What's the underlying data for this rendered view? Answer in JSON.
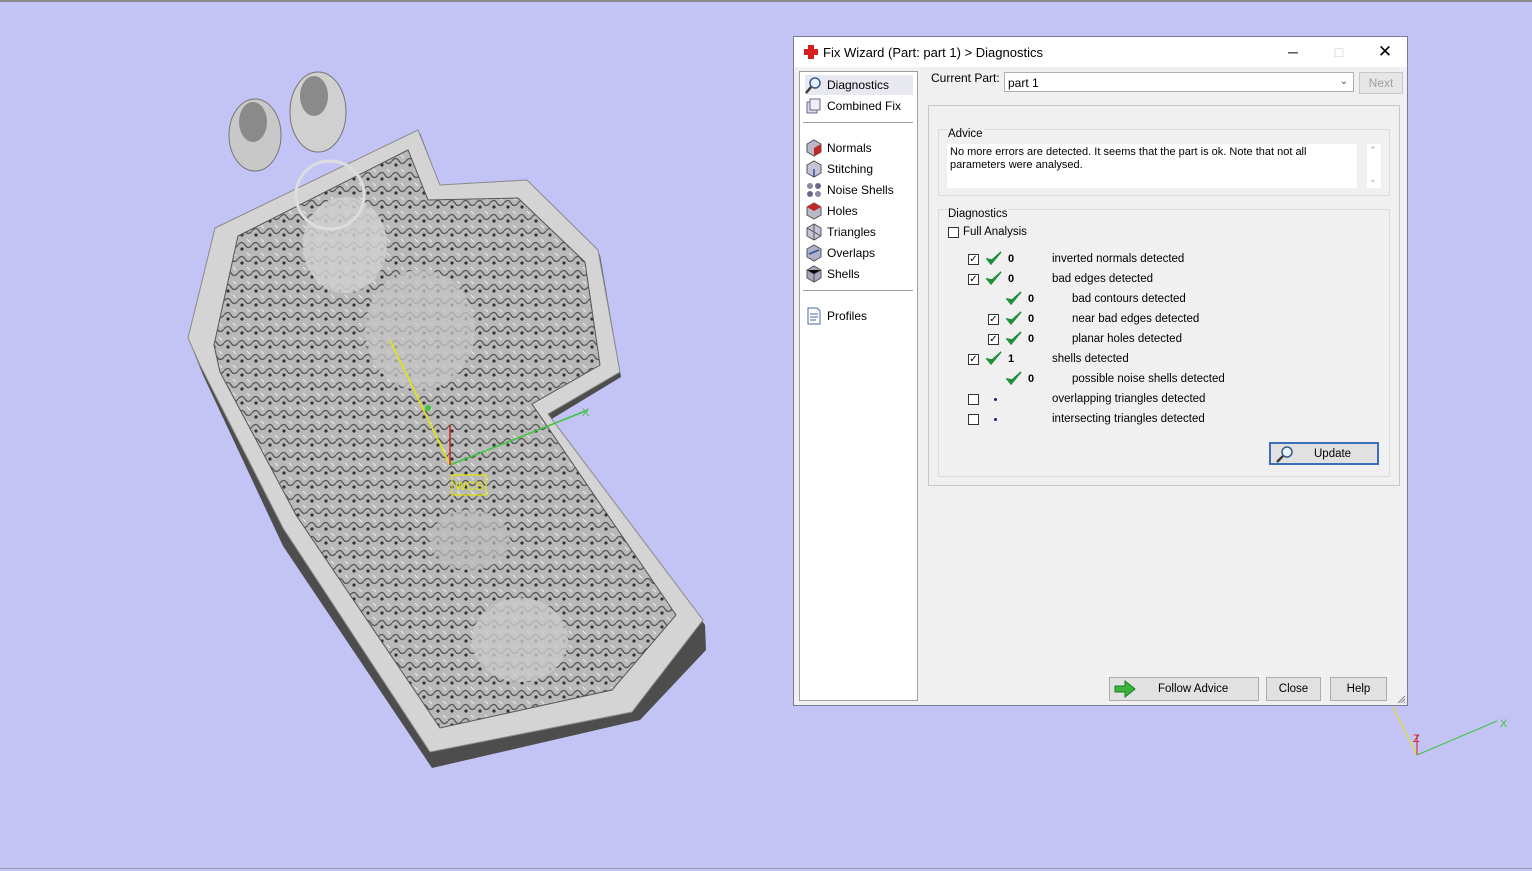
{
  "window": {
    "title": "Fix Wizard (Part: part 1) > Diagnostics",
    "controls": {
      "minimize": "─",
      "maximize": "□",
      "close": "✕"
    }
  },
  "nav": {
    "items": [
      {
        "label": "Diagnostics",
        "icon": "magnifier-icon",
        "selected": true
      },
      {
        "label": "Combined Fix",
        "icon": "combined-fix-icon",
        "selected": false
      },
      {
        "label": "Normals",
        "icon": "normals-cube-icon",
        "selected": false
      },
      {
        "label": "Stitching",
        "icon": "stitching-cube-icon",
        "selected": false
      },
      {
        "label": "Noise Shells",
        "icon": "noise-shells-icon",
        "selected": false
      },
      {
        "label": "Holes",
        "icon": "holes-cube-icon",
        "selected": false
      },
      {
        "label": "Triangles",
        "icon": "triangles-cube-icon",
        "selected": false
      },
      {
        "label": "Overlaps",
        "icon": "overlaps-cube-icon",
        "selected": false
      },
      {
        "label": "Shells",
        "icon": "shells-cube-icon",
        "selected": false
      },
      {
        "label": "Profiles",
        "icon": "profiles-document-icon",
        "selected": false
      }
    ]
  },
  "current_part": {
    "label": "Current Part:",
    "value": "part 1",
    "next_label": "Next"
  },
  "advice": {
    "title": "Advice",
    "text": "No more errors are detected. It seems that the part is ok. Note that not all parameters were analysed."
  },
  "diagnostics": {
    "title": "Diagnostics",
    "full_analysis": {
      "label": "Full Analysis",
      "checked": false
    },
    "rows": [
      {
        "checkbox": true,
        "checked": true,
        "status": "ok",
        "value": "0",
        "label": "inverted normals detected",
        "indent": 0
      },
      {
        "checkbox": true,
        "checked": true,
        "status": "ok",
        "value": "0",
        "label": "bad edges detected",
        "indent": 0
      },
      {
        "checkbox": false,
        "checked": false,
        "status": "ok",
        "value": "0",
        "label": "bad contours detected",
        "indent": 1
      },
      {
        "checkbox": true,
        "checked": true,
        "status": "ok",
        "value": "0",
        "label": "near bad edges detected",
        "indent": 1
      },
      {
        "checkbox": true,
        "checked": true,
        "status": "ok",
        "value": "0",
        "label": "planar holes detected",
        "indent": 1
      },
      {
        "checkbox": true,
        "checked": true,
        "status": "ok",
        "value": "1",
        "label": "shells detected",
        "indent": 0
      },
      {
        "checkbox": false,
        "checked": false,
        "status": "ok",
        "value": "0",
        "label": "possible noise shells detected",
        "indent": 1
      },
      {
        "checkbox": true,
        "checked": false,
        "status": "none",
        "value": "",
        "label": "overlapping triangles detected",
        "indent": 0
      },
      {
        "checkbox": true,
        "checked": false,
        "status": "none",
        "value": "",
        "label": "intersecting triangles detected",
        "indent": 0
      }
    ],
    "update_label": "Update"
  },
  "buttons": {
    "follow_advice": "Follow Advice",
    "close": "Close",
    "help": "Help"
  },
  "viewport": {
    "wcs_label": "WCS",
    "axis_x": "X",
    "axis_z": "Z"
  },
  "colors": {
    "background": "#c3c3f5",
    "check_green": "#1f8f3a",
    "accent": "#3d6fb8"
  }
}
